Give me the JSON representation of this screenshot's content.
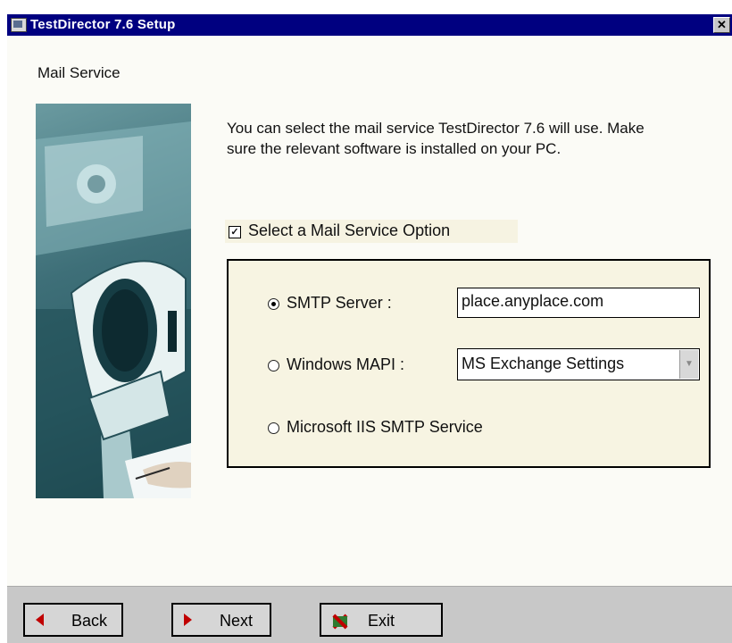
{
  "window": {
    "title": "TestDirector 7.6 Setup",
    "close_symbol": "✕"
  },
  "page": {
    "title": "Mail Service",
    "intro": "You can select the mail service TestDirector 7.6 will use. Make sure the relevant software is installed on your PC."
  },
  "mail_option": {
    "checked": true,
    "check_mark": "✓",
    "label": "Select a Mail Service Option"
  },
  "services": {
    "smtp": {
      "label": "SMTP Server :",
      "selected": true,
      "value": "place.anyplace.com"
    },
    "mapi": {
      "label": "Windows MAPI :",
      "selected": false,
      "value": "MS Exchange Settings",
      "arrow": "▼"
    },
    "iis": {
      "label": "Microsoft IIS SMTP Service",
      "selected": false
    }
  },
  "buttons": {
    "back": "Back",
    "next": "Next",
    "exit": "Exit"
  },
  "icons": {
    "app": "setup-app-icon",
    "back": "triangle-left-icon",
    "next": "triangle-right-icon",
    "exit": "exit-x-icon"
  },
  "colors": {
    "titlebar": "#000080",
    "panel": "#f7f4e2",
    "button_icon_red": "#c00000"
  }
}
